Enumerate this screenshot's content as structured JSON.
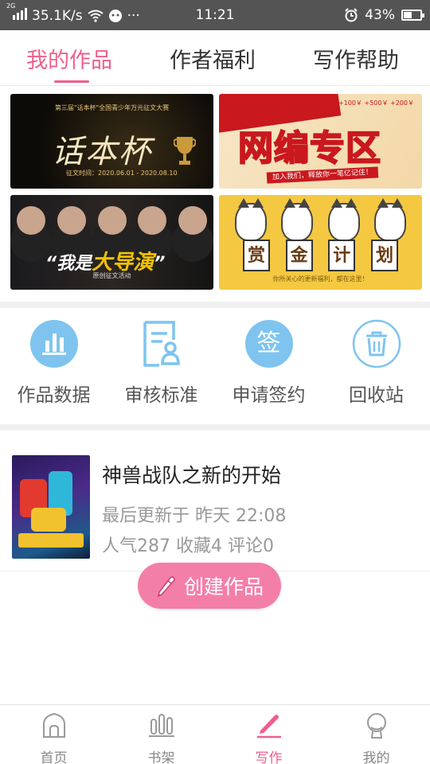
{
  "status_bar": {
    "network_type": "2G",
    "speed": "35.1K/s",
    "more": "···",
    "time": "11:21",
    "battery": "43%"
  },
  "tabs": [
    {
      "label": "我的作品",
      "active": true
    },
    {
      "label": "作者福利",
      "active": false
    },
    {
      "label": "写作帮助",
      "active": false
    }
  ],
  "banners": {
    "contest": {
      "caption": "第三届\"话本杯\"全国青少年万元征文大赛",
      "title": "话本杯",
      "date": "征文时间：2020.06.01 - 2020.08.10"
    },
    "web_serial": {
      "title": "网编专区",
      "strip": "加入我们，释放你一笔亿记住！",
      "stamps": [
        "+100￥",
        "+500￥",
        "+200￥"
      ]
    },
    "director": {
      "title_pre": "“我是",
      "title_big": "大导演",
      "title_post": "”",
      "small": "原创征文活动"
    },
    "reward": {
      "chars": [
        "赏",
        "金",
        "计",
        "划"
      ],
      "small": "你所关心的更新福利，都在这里！"
    }
  },
  "functions": [
    {
      "label": "作品数据",
      "icon": "bar-chart-icon"
    },
    {
      "label": "审核标准",
      "icon": "review-doc-icon"
    },
    {
      "label": "申请签约",
      "icon": "sign-icon",
      "icon_text": "签"
    },
    {
      "label": "回收站",
      "icon": "trash-icon"
    }
  ],
  "work": {
    "title": "神兽战队之新的开始",
    "updated": "最后更新于 昨天 22:08",
    "stats": "人气287 收藏4 评论0"
  },
  "create_button": {
    "label": "创建作品"
  },
  "bottom_nav": [
    {
      "label": "首页",
      "icon": "home-icon",
      "active": false
    },
    {
      "label": "书架",
      "icon": "bookshelf-icon",
      "active": false
    },
    {
      "label": "写作",
      "icon": "pen-icon",
      "active": true
    },
    {
      "label": "我的",
      "icon": "profile-icon",
      "active": false
    }
  ],
  "colors": {
    "accent": "#ee5f8c",
    "button": "#f37fa8",
    "icon_blue": "#7ec4ef",
    "muted_text": "#999999"
  }
}
